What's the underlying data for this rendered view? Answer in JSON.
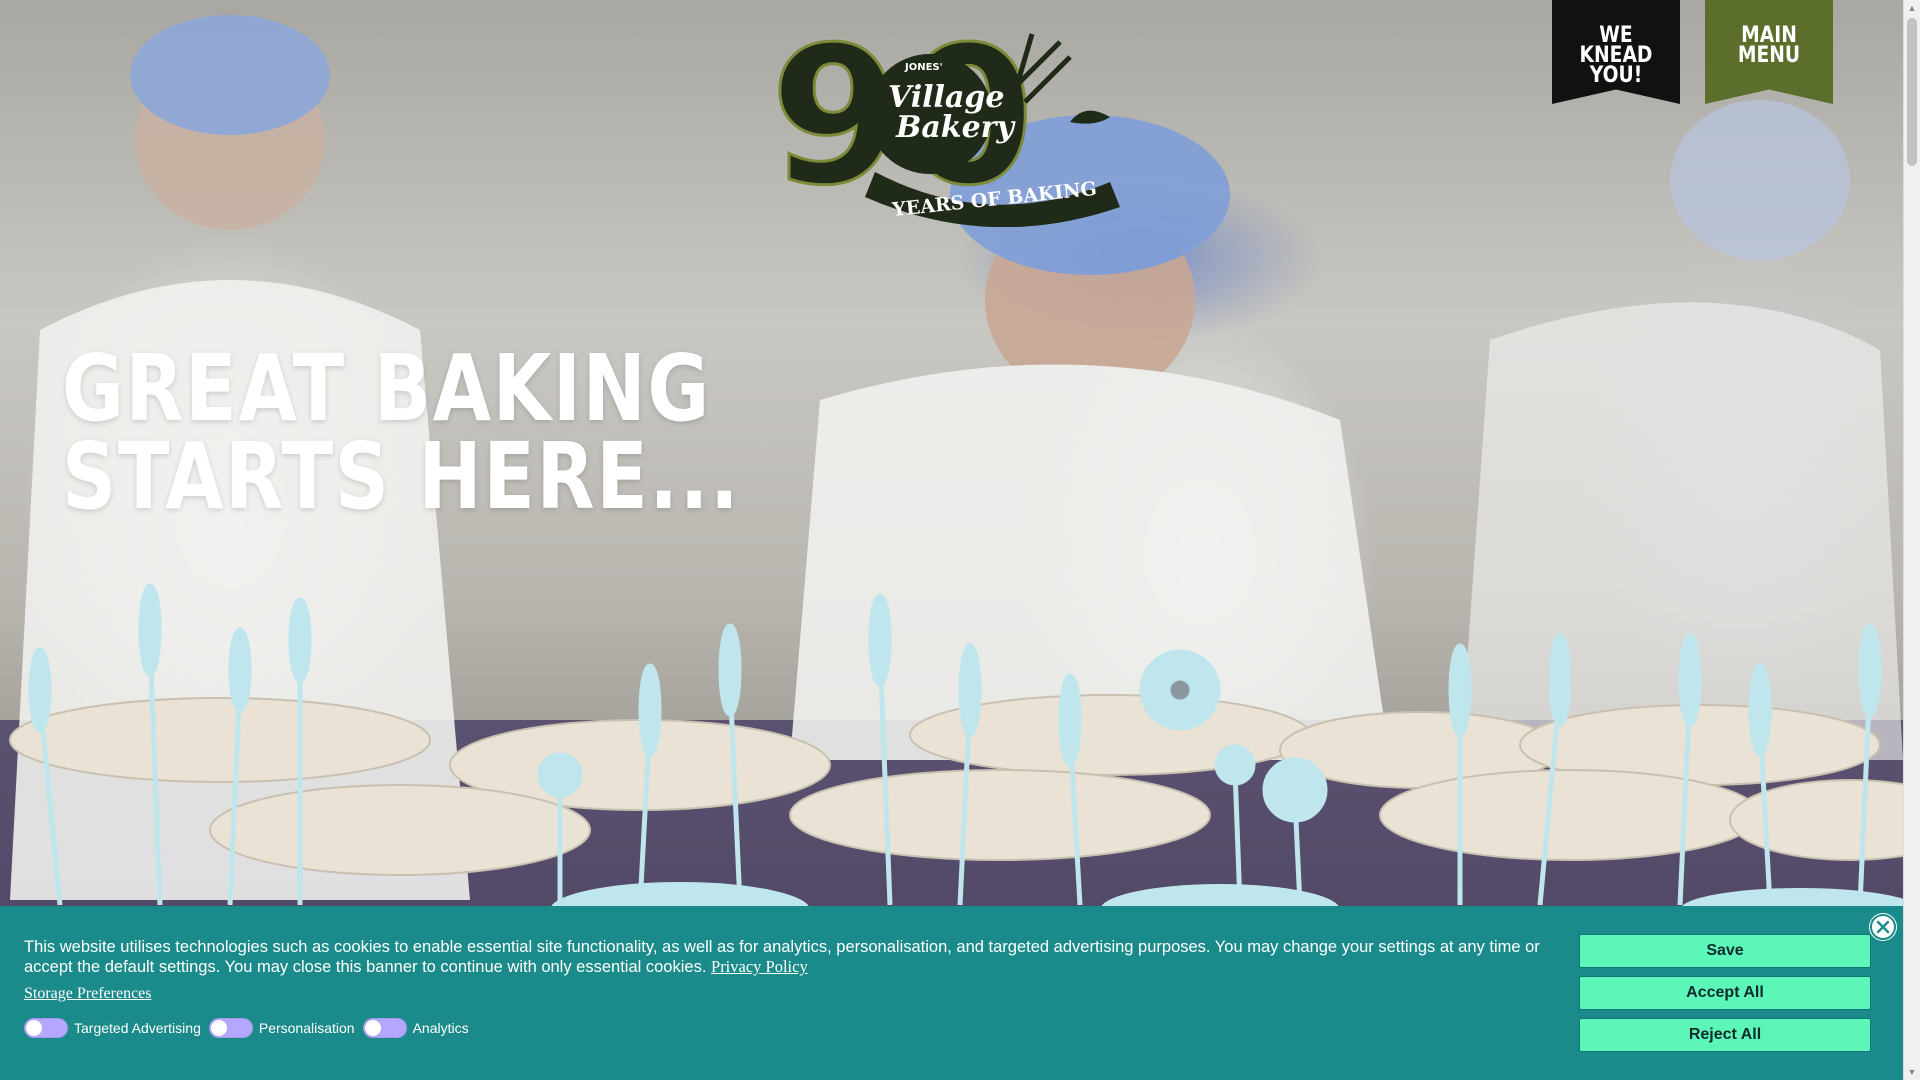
{
  "header": {
    "logo": {
      "number": "90",
      "maker": "JONES'",
      "brand_line1": "Village",
      "brand_line2": "Bakery",
      "tagline": "YEARS OF BAKING"
    },
    "knead_label": "WE KNEAD YOU!",
    "menu_label": "MAIN MENU"
  },
  "hero": {
    "title_line1": "GREAT BAKING",
    "title_line2": "STARTS HERE..."
  },
  "cookie_banner": {
    "message": "This website utilises technologies such as cookies to enable essential site functionality, as well as for analytics, personalisation, and targeted advertising purposes. You may change your settings at any time or accept the default settings. You may close this banner to continue with only essential cookies.",
    "privacy_link": "Privacy Policy",
    "storage_preferences": "Storage Preferences",
    "toggles": [
      {
        "label": "Targeted Advertising",
        "on": false
      },
      {
        "label": "Personalisation",
        "on": false
      },
      {
        "label": "Analytics",
        "on": false
      }
    ],
    "save_label": "Save",
    "accept_label": "Accept All",
    "reject_label": "Reject All"
  },
  "colors": {
    "banner_bg": "#1b8a8a",
    "button_bg": "#5cf7b8",
    "toggle_off": "#b3a7ff",
    "menu_flag": "#5b6e2b",
    "knead_flag": "#111111",
    "plant_blue": "#bfe6ec"
  },
  "icons": {
    "close": "close-icon",
    "scroll_up": "arrow-up-icon",
    "scroll_down": "arrow-down-icon"
  }
}
